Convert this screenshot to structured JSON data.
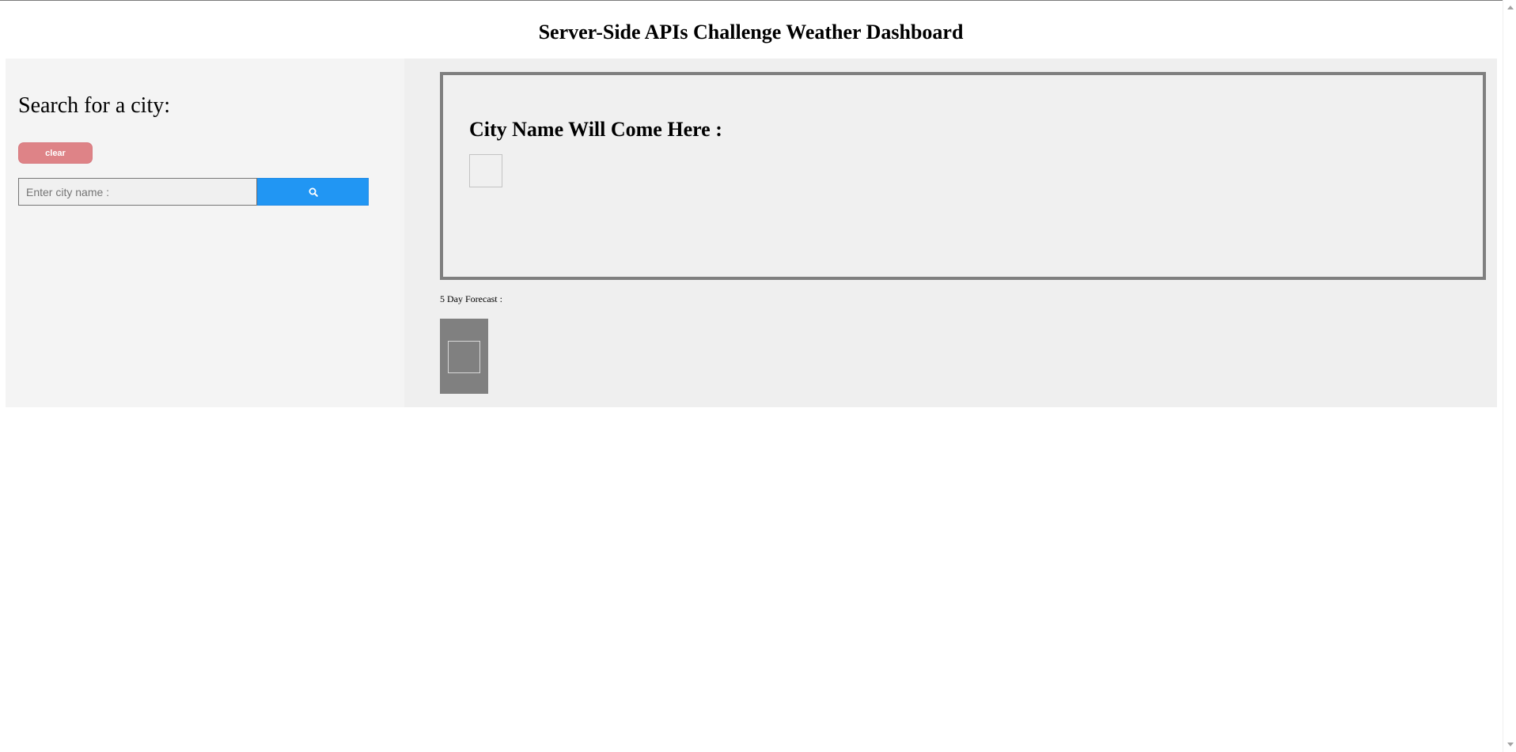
{
  "header": {
    "title": "Server-Side APIs Challenge Weather Dashboard"
  },
  "sidebar": {
    "heading": "Search for a city:",
    "clear_label": "clear",
    "search": {
      "value": "",
      "placeholder": "Enter city name :",
      "button_icon": "search-icon"
    }
  },
  "current_weather": {
    "city_name": "City Name Will Come Here :",
    "icon": "weather-icon-placeholder"
  },
  "forecast": {
    "label": "5 Day Forecast :",
    "cards": [
      {
        "icon": "weather-icon-placeholder"
      }
    ]
  },
  "colors": {
    "clear_button": "#de8387",
    "search_button": "#2196f3",
    "sidebar_bg": "#f4f4f4",
    "main_bg": "#efefef",
    "current_border": "#7f7f7f",
    "forecast_card": "#808080"
  }
}
